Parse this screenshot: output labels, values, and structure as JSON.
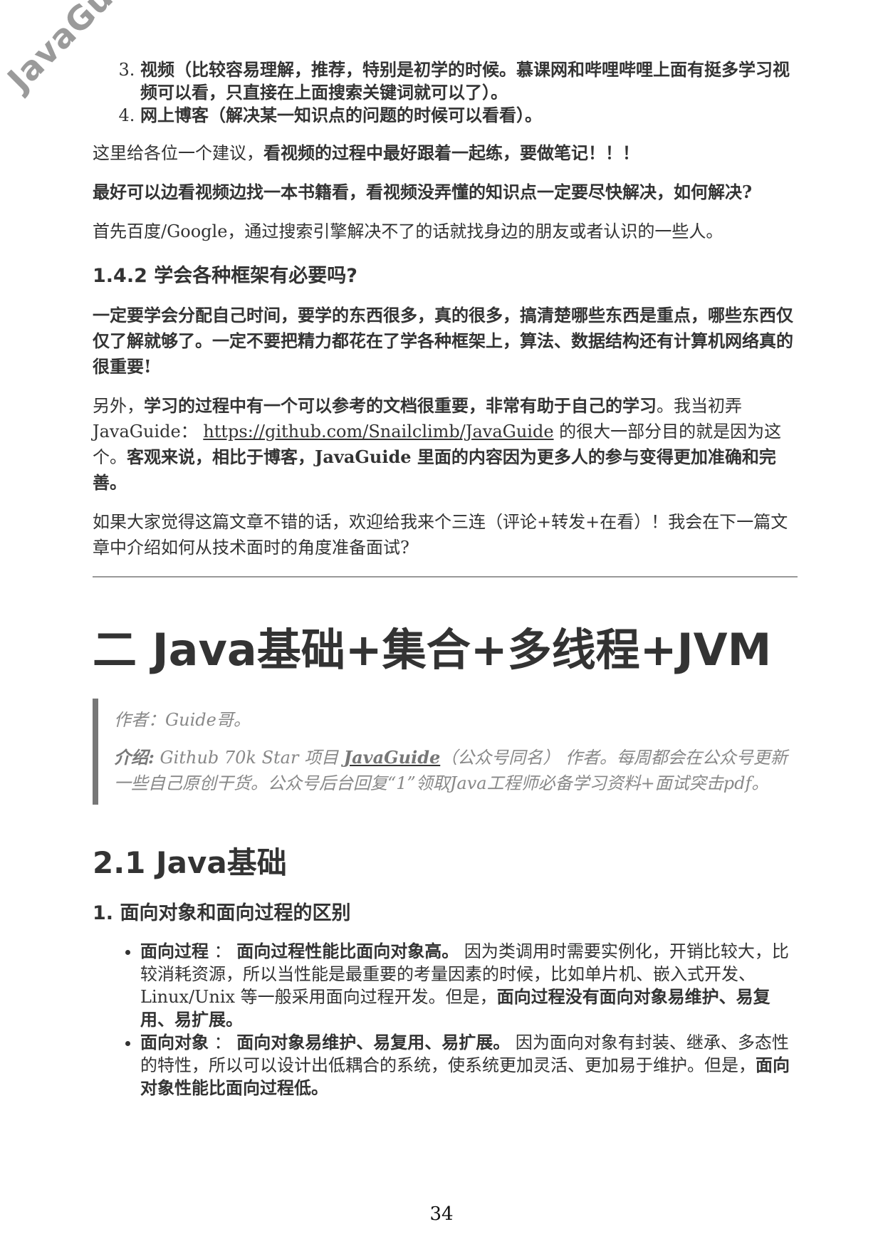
{
  "watermark": "JavaGuide",
  "list_top": [
    "视频（比较容易理解，推荐，特别是初学的时候。慕课网和哔哩哔哩上面有挺多学习视频可以看，只直接在上面搜索关键词就可以了）。",
    "网上博客（解决某一知识点的问题的时候可以看看）。"
  ],
  "p1": {
    "a": "这里给各位一个建议，",
    "b": "看视频的过程中最好跟着一起练，要做笔记！！！"
  },
  "p2": "最好可以边看视频边找一本书籍看，看视频没弄懂的知识点一定要尽快解决，如何解决?",
  "p3": "首先百度/Google，通过搜索引擎解决不了的话就找身边的朋友或者认识的一些人。",
  "h_142": "1.4.2 学会各种框架有必要吗?",
  "p4": "一定要学会分配自己时间，要学的东西很多，真的很多，搞清楚哪些东西是重点，哪些东西仅仅了解就够了。一定不要把精力都花在了学各种框架上，算法、数据结构还有计算机网络真的很重要!",
  "p5": {
    "a": "另外，",
    "b": "学习的过程中有一个可以参考的文档很重要，非常有助于自己的学习",
    "c": "。我当初弄 JavaGuide：",
    "link": "https://github.com/Snailclimb/JavaGuide",
    "d": " 的很大一部分目的就是因为这个。",
    "e": "客观来说，相比于博客，JavaGuide 里面的内容因为更多人的参与变得更加准确和完善。"
  },
  "p6": "如果大家觉得这篇文章不错的话，欢迎给我来个三连（评论+转发+在看）！我会在下一篇文章中介绍如何从技术面时的角度准备面试?",
  "chapter_title": "二 Java基础+集合+多线程+JVM",
  "quote": {
    "author": "作者：Guide哥。",
    "intro_label": "介绍:",
    "intro_a": " Github 70k Star 项目 ",
    "intro_link": "JavaGuide",
    "intro_b": "（公众号同名） 作者。每周都会在公众号更新一些自己原创干货。公众号后台回复“1”领取Java工程师必备学习资料+面试突击pdf。"
  },
  "h_21": "2.1 Java基础",
  "h_1": "1. 面向对象和面向过程的区别",
  "bullets": [
    {
      "label": "面向过程",
      "sep": " ： ",
      "bold1": "面向过程性能比面向对象高。",
      "text": " 因为类调用时需要实例化，开销比较大，比较消耗资源，所以当性能是最重要的考量因素的时候，比如单片机、嵌入式开发、Linux/Unix 等一般采用面向过程开发。但是，",
      "bold2": "面向过程没有面向对象易维护、易复用、易扩展。"
    },
    {
      "label": "面向对象",
      "sep": " ： ",
      "bold1": "面向对象易维护、易复用、易扩展。",
      "text": " 因为面向对象有封装、继承、多态性的特性，所以可以设计出低耦合的系统，使系统更加灵活、更加易于维护。但是，",
      "bold2": "面向对象性能比面向过程低。"
    }
  ],
  "page_number": "34"
}
